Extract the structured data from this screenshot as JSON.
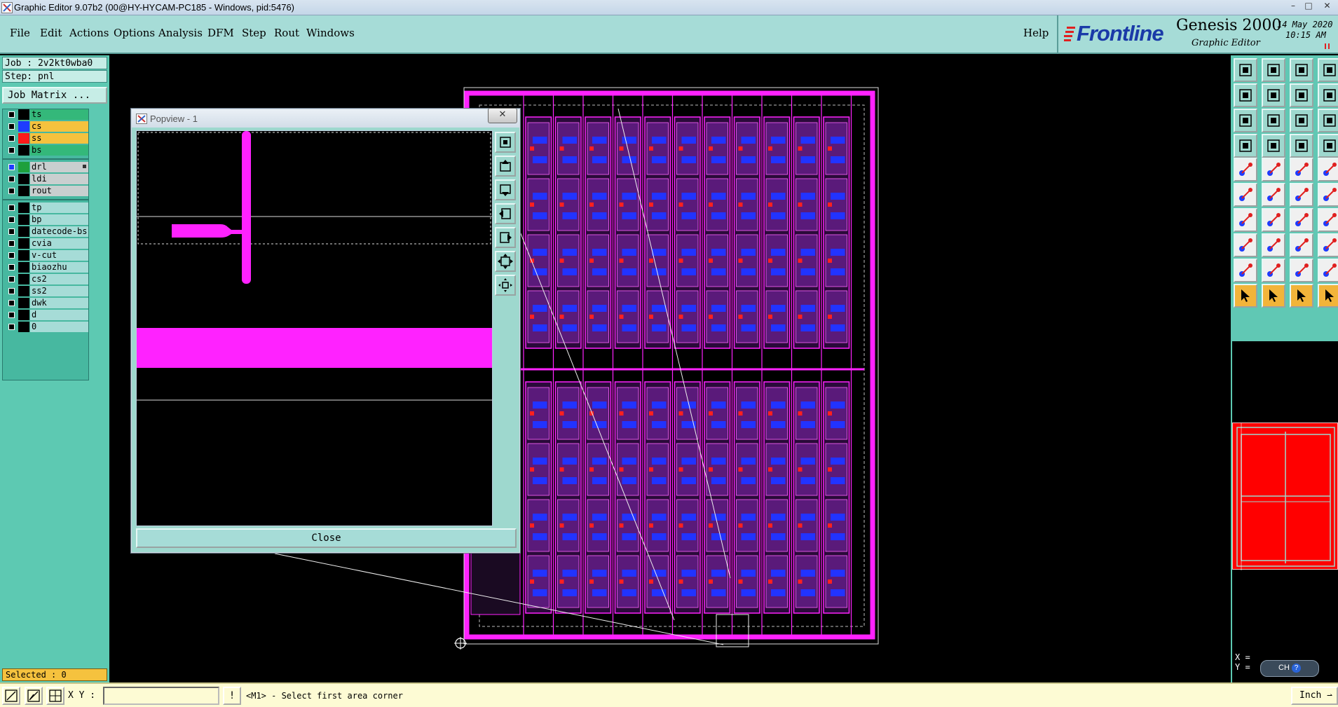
{
  "window": {
    "title": "Graphic Editor 9.07b2 (00@HY-HYCAM-PC185 - Windows, pid:5476)",
    "controls": [
      "–",
      "□",
      "✕"
    ]
  },
  "menu": {
    "items": [
      "File",
      "Edit",
      "Actions",
      "Options",
      "Analysis",
      "DFM",
      "Step",
      "Rout",
      "Windows"
    ],
    "help": "Help"
  },
  "brand": {
    "logo": "Frontline",
    "product": "Genesis 2000",
    "subtitle": "Graphic Editor",
    "date": "14 May 2020",
    "time": "10:15 AM"
  },
  "job": {
    "job_line": "Job : 2v2kt0wba0",
    "step_line": "Step: pnl",
    "matrix_button": "Job Matrix ..."
  },
  "layer_groups": [
    {
      "layers": [
        {
          "name": "ts",
          "swatch": "#000000",
          "bg": "#34b87a"
        },
        {
          "name": "cs",
          "swatch": "#1e3cff",
          "bg": "#f5c23e"
        },
        {
          "name": "ss",
          "swatch": "#ff1a1a",
          "bg": "#f5c23e"
        },
        {
          "name": "bs",
          "swatch": "#000000",
          "bg": "#34b87a"
        }
      ]
    },
    {
      "layers": [
        {
          "name": "drl",
          "swatch": "#1ea03c",
          "bg": "#c9cfcf",
          "marked": true,
          "active": true
        },
        {
          "name": "ldi",
          "swatch": "#000000",
          "bg": "#c9cfcf"
        },
        {
          "name": "rout",
          "swatch": "#000000",
          "bg": "#c9cfcf"
        }
      ]
    },
    {
      "layers": [
        {
          "name": "tp",
          "swatch": "#000000",
          "bg": "#a6dcd7"
        },
        {
          "name": "bp",
          "swatch": "#000000",
          "bg": "#a6dcd7"
        },
        {
          "name": "datecode-bs",
          "swatch": "#000000",
          "bg": "#a6dcd7"
        },
        {
          "name": "cvia",
          "swatch": "#000000",
          "bg": "#a6dcd7"
        },
        {
          "name": "v-cut",
          "swatch": "#000000",
          "bg": "#a6dcd7"
        },
        {
          "name": "biaozhu",
          "swatch": "#000000",
          "bg": "#a6dcd7"
        },
        {
          "name": "cs2",
          "swatch": "#000000",
          "bg": "#a6dcd7"
        },
        {
          "name": "ss2",
          "swatch": "#000000",
          "bg": "#a6dcd7"
        },
        {
          "name": "dwk",
          "swatch": "#000000",
          "bg": "#a6dcd7"
        },
        {
          "name": "d",
          "swatch": "#000000",
          "bg": "#a6dcd7"
        },
        {
          "name": "0",
          "swatch": "#000000",
          "bg": "#a6dcd7"
        }
      ]
    }
  ],
  "selected": "Selected : 0",
  "statusbar": {
    "xy_label": "X Y :",
    "xy_value": "",
    "prompt": "<M1> - Select first area corner",
    "units": "Inch"
  },
  "coords": {
    "x_label": "X =",
    "y_label": "Y =",
    "ime": "CH"
  },
  "popview": {
    "title": "Popview - 1",
    "close_label": "Close"
  },
  "colors": {
    "panel": "#5dc9b2",
    "menu_bg": "#a6dcd7",
    "board": "#ff22ff",
    "canvas": "#000000",
    "minimap": "#ff0000",
    "status_bg": "#fdfbd4"
  }
}
